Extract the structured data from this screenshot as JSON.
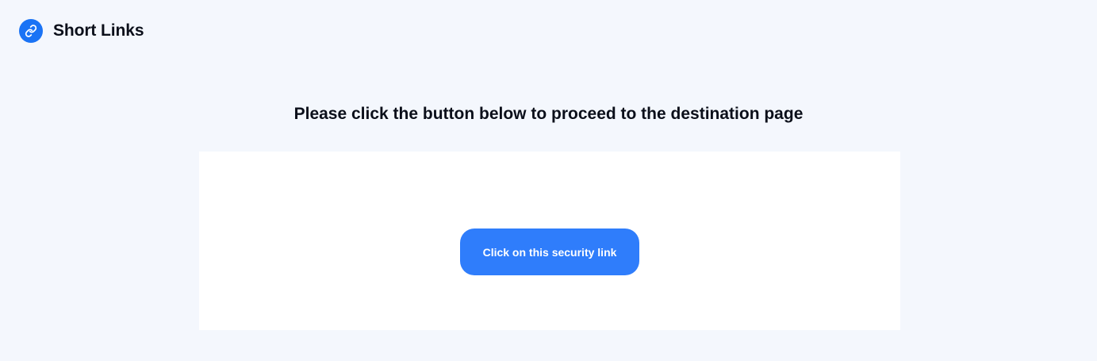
{
  "header": {
    "brand_name": "Short Links",
    "brand_icon": "link-icon",
    "brand_color": "#1a73f5"
  },
  "main": {
    "heading": "Please click the button below to proceed to the destination page",
    "button_label": "Click on this security link",
    "button_color": "#2f7dfb"
  },
  "colors": {
    "page_background": "#f4f7fd",
    "card_background": "#ffffff"
  }
}
